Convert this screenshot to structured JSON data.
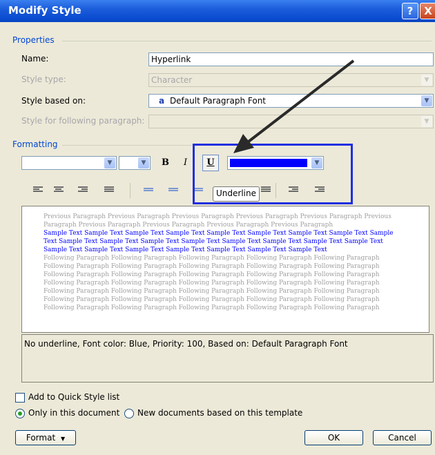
{
  "window": {
    "title": "Modify Style"
  },
  "title_buttons": {
    "help": "?",
    "close": "X"
  },
  "properties": {
    "section_label": "Properties",
    "name_label": "Name:",
    "name_value": "Hyperlink",
    "style_type_label": "Style type:",
    "style_type_value": "Character",
    "based_on_label": "Style based on:",
    "based_on_icon": "a",
    "based_on_value": "Default Paragraph Font",
    "following_label": "Style for following paragraph:",
    "following_value": ""
  },
  "formatting": {
    "section_label": "Formatting",
    "bold": "B",
    "italic": "I",
    "underline": "U",
    "font_color": "#0000ff",
    "tooltip": "Underline"
  },
  "preview": {
    "previous_para": "Previous Paragraph Previous Paragraph Previous Paragraph Previous Paragraph Previous Paragraph Previous Paragraph Previous Paragraph Previous Paragraph Previous Paragraph Previous Paragraph",
    "sample": "Sample Text Sample Text Sample Text Sample Text Sample Text Sample Text Sample Text Sample Text Sample Text Sample Text Sample Text Sample Text Sample Text Sample Text Sample Text Sample Text Sample Text Sample Text Sample Text Sample Text Sample Text Sample Text Sample Text Sample Text",
    "following_para": "Following Paragraph Following Paragraph Following Paragraph Following Paragraph Following Paragraph Following Paragraph Following Paragraph Following Paragraph Following Paragraph Following Paragraph Following Paragraph Following Paragraph Following Paragraph Following Paragraph Following Paragraph Following Paragraph Following Paragraph Following Paragraph Following Paragraph Following Paragraph Following Paragraph Following Paragraph Following Paragraph Following Paragraph Following Paragraph Following Paragraph Following Paragraph Following Paragraph Following Paragraph Following Paragraph Following Paragraph Following Paragraph Following Paragraph Following Paragraph Following Paragraph"
  },
  "description": "No underline, Font color: Blue, Priority: 100, Based on: Default Paragraph Font",
  "options": {
    "quick_style": "Add to Quick Style list",
    "only_doc": "Only in this document",
    "new_docs": "New documents based on this template"
  },
  "buttons": {
    "format": "Format",
    "ok": "OK",
    "cancel": "Cancel"
  },
  "colors": {
    "accent": "#0046d5",
    "highlight": "#1f2fe0"
  }
}
